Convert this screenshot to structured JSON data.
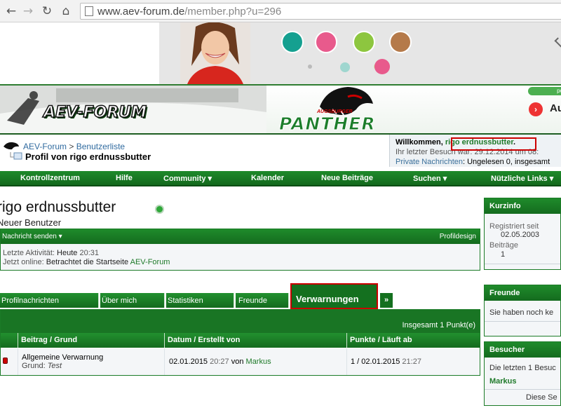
{
  "browser": {
    "url_host": "www.aev-forum.de",
    "url_path": "/member.php?u=296",
    "back_icon": "back-arrow-icon",
    "forward_icon": "forward-arrow-icon",
    "reload_icon": "reload-icon",
    "home_icon": "home-icon"
  },
  "header": {
    "logo_text": "AEV-FORUM",
    "team_logo_small": "AUGSBURGER",
    "team_logo": "PANTHER",
    "right_partial": "Au",
    "pill_text": "pov"
  },
  "breadcrumb": {
    "home": "AEV-Forum",
    "separator": ">",
    "members": "Benutzerliste",
    "title": "Profil von rigo erdnussbutter"
  },
  "welcome": {
    "greeting": "Willkommen, ",
    "username": "rigo erdnussbutter",
    "dot": ".",
    "last_visit": "Ihr letzter Besuch war: 29.12.2014 um 08:",
    "pm_label": "Private Nachrichten",
    "pm_info": ": Ungelesen 0, insgesamt"
  },
  "nav": {
    "items": [
      {
        "label": "Kontrollzentrum"
      },
      {
        "label": "Hilfe"
      },
      {
        "label": "Community ▾"
      },
      {
        "label": "Kalender"
      },
      {
        "label": "Neue Beiträge"
      },
      {
        "label": "Suchen ▾"
      },
      {
        "label": "Nützliche Links ▾"
      }
    ]
  },
  "profile": {
    "username": "rigo erdnussbutter",
    "usertitle": "Neuer Benutzer",
    "send_message": "Nachricht senden ▾",
    "profile_design": "Profildesign",
    "last_activity_label": "Letzte Aktivität:",
    "last_activity_day": "Heute",
    "last_activity_time": "20:31",
    "online_label": "Jetzt online:",
    "online_text": "Betrachtet die Startseite",
    "online_link": "AEV-Forum"
  },
  "tabs": {
    "items": [
      {
        "label": "Profilnachrichten"
      },
      {
        "label": "Über mich"
      },
      {
        "label": "Statistiken"
      },
      {
        "label": "Freunde"
      }
    ],
    "active": "Verwarnungen",
    "more": "»"
  },
  "warnings": {
    "total": "Insgesamt 1 Punkt(e)",
    "columns": [
      "Beitrag / Grund",
      "Datum / Erstellt von",
      "Punkte / Läuft ab"
    ],
    "row": {
      "title": "Allgemeine Verwarnung",
      "reason_label": "Grund:",
      "reason": "Test",
      "date": "02.01.2015",
      "time": "20:27",
      "by": "von",
      "author": "Markus",
      "points": "1 / 02.01.2015",
      "expires_time": "21:27"
    }
  },
  "sidebar": {
    "kurzinfo": {
      "title": "Kurzinfo",
      "registered_label": "Registriert seit",
      "registered": "02.05.2003",
      "posts_label": "Beiträge",
      "posts": "1"
    },
    "freunde": {
      "title": "Freunde",
      "text": "Sie haben noch ke"
    },
    "besucher": {
      "title": "Besucher",
      "text": "Die letzten 1 Besuc",
      "visitor": "Markus",
      "footer": "Diese Se"
    }
  }
}
